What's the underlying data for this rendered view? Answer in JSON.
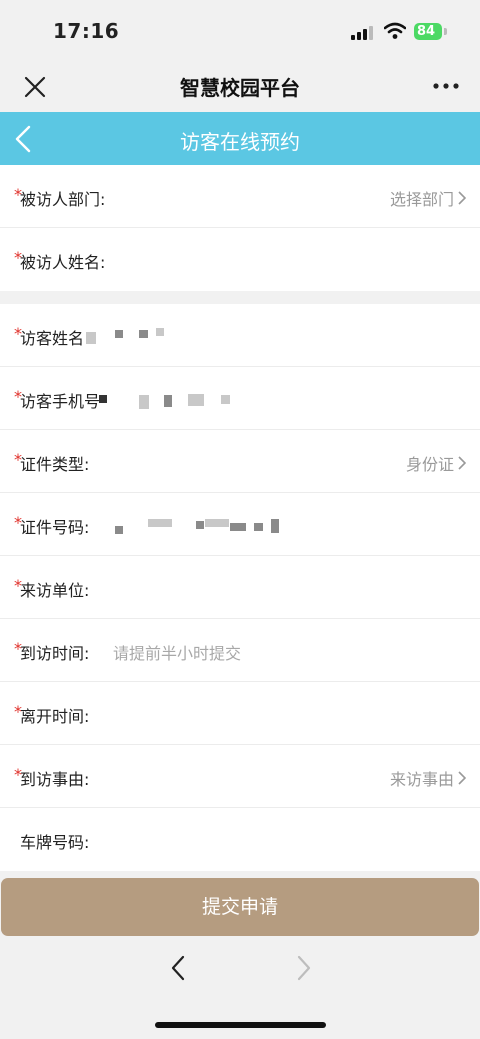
{
  "status_bar": {
    "time": "17:16",
    "battery": "84"
  },
  "app_header": {
    "title": "智慧校园平台"
  },
  "page_header": {
    "title": "访客在线预约"
  },
  "host_section": [
    {
      "label": "被访人部门:",
      "required": true,
      "value": "选择部门",
      "chevron": true
    },
    {
      "label": "被访人姓名:",
      "required": true
    }
  ],
  "visitor_section": [
    {
      "label": "访客姓名",
      "required": true
    },
    {
      "label": "访客手机号",
      "required": true
    },
    {
      "label": "证件类型:",
      "required": true,
      "value": "身份证",
      "chevron": true
    },
    {
      "label": "证件号码:",
      "required": true
    },
    {
      "label": "来访单位:",
      "required": true
    },
    {
      "label": "到访时间:",
      "required": true,
      "placeholder": "请提前半小时提交"
    },
    {
      "label": "离开时间:",
      "required": true
    },
    {
      "label": "到访事由:",
      "required": true,
      "value": "来访事由",
      "chevron": true
    },
    {
      "label": "车牌号码:",
      "required": false
    }
  ],
  "required_mark": "*",
  "submit_label": "提交申请",
  "icons": {
    "close": "close-icon",
    "more": "more-icon",
    "back": "chevron-left-icon",
    "row_arrow": "chevron-right-icon",
    "nav_back": "chevron-left-icon",
    "nav_forward": "chevron-right-icon"
  },
  "colors": {
    "header_bg": "#5bc7e3",
    "submit_bg": "#b59c80",
    "required": "#e0312b",
    "battery": "#4cd964"
  }
}
